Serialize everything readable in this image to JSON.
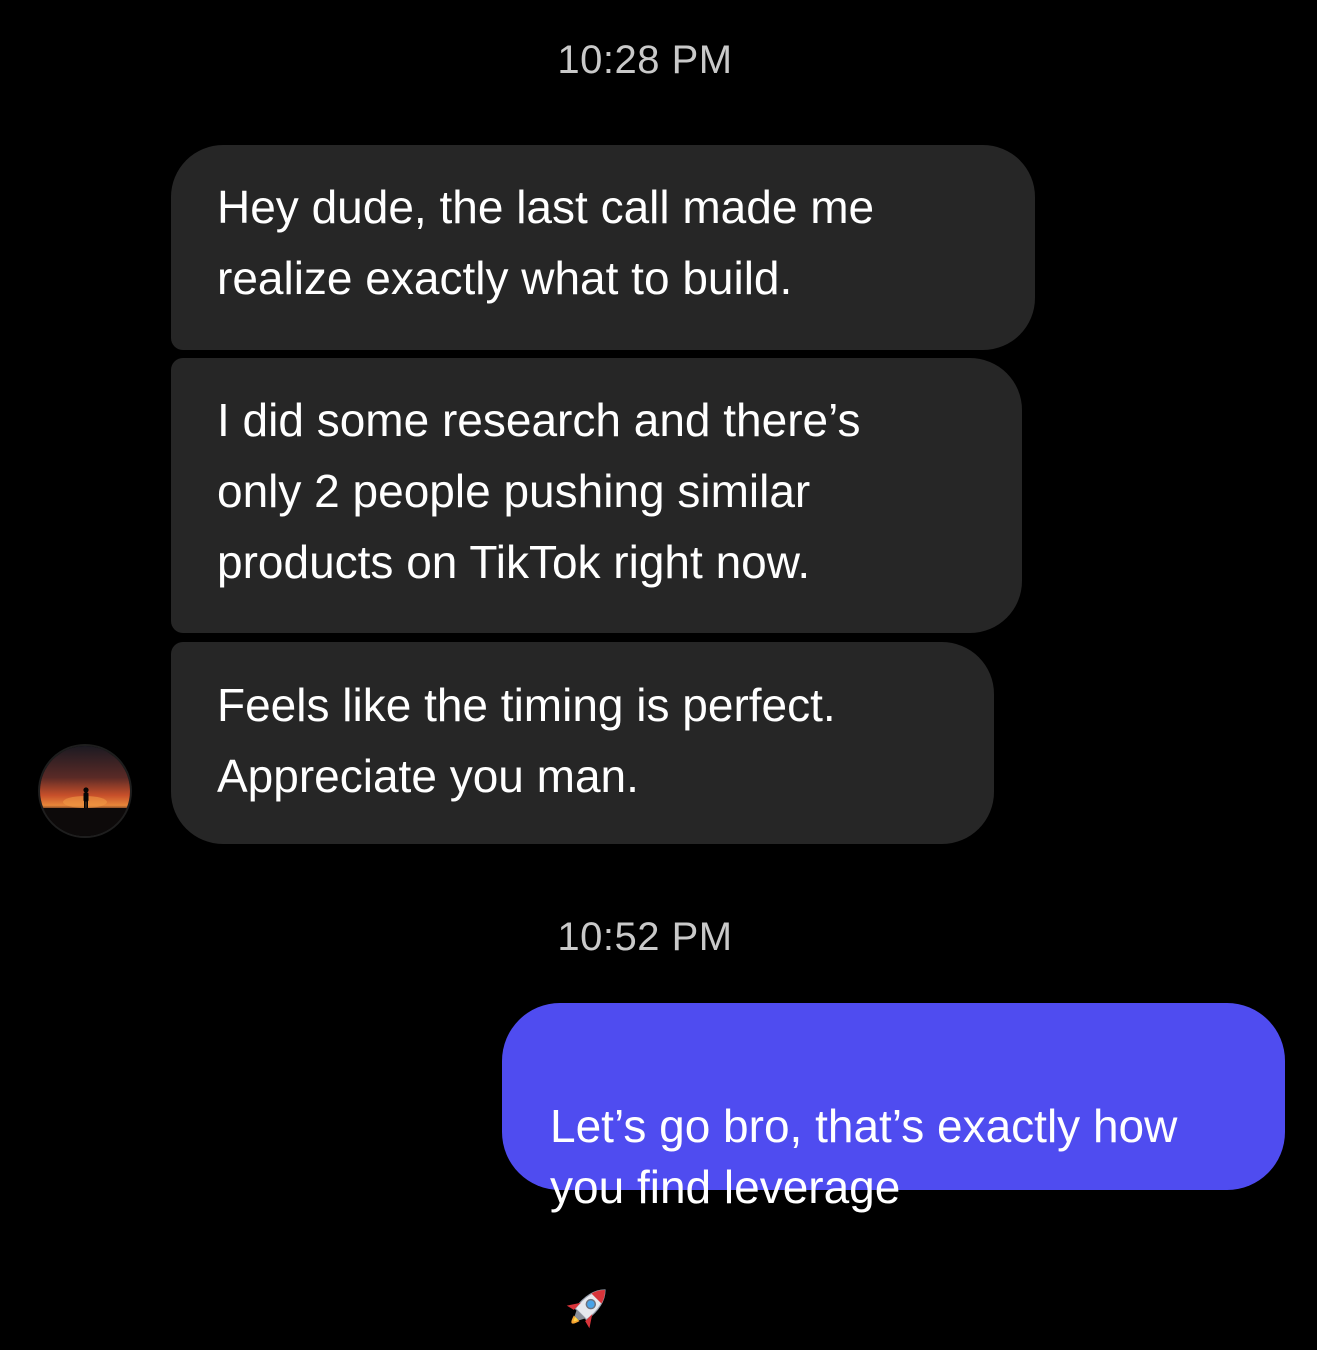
{
  "thread": {
    "timestamps": [
      "10:28 PM",
      "10:52 PM"
    ],
    "incoming": [
      "Hey dude, the last call made me\nrealize exactly what to build.",
      "I did some research and there’s\nonly 2 people pushing similar\nproducts on TikTok right now.",
      "Feels like the timing is perfect.\nAppreciate you man."
    ],
    "outgoing": [
      {
        "text": "Let’s go bro, that’s exactly how\nyou find leverage",
        "emoji": "rocket-icon"
      }
    ]
  },
  "colors": {
    "background": "#000000",
    "incoming_bubble": "#262626",
    "outgoing_bubble": "#4f4cf0",
    "timestamp_text": "#c9c9c9"
  }
}
